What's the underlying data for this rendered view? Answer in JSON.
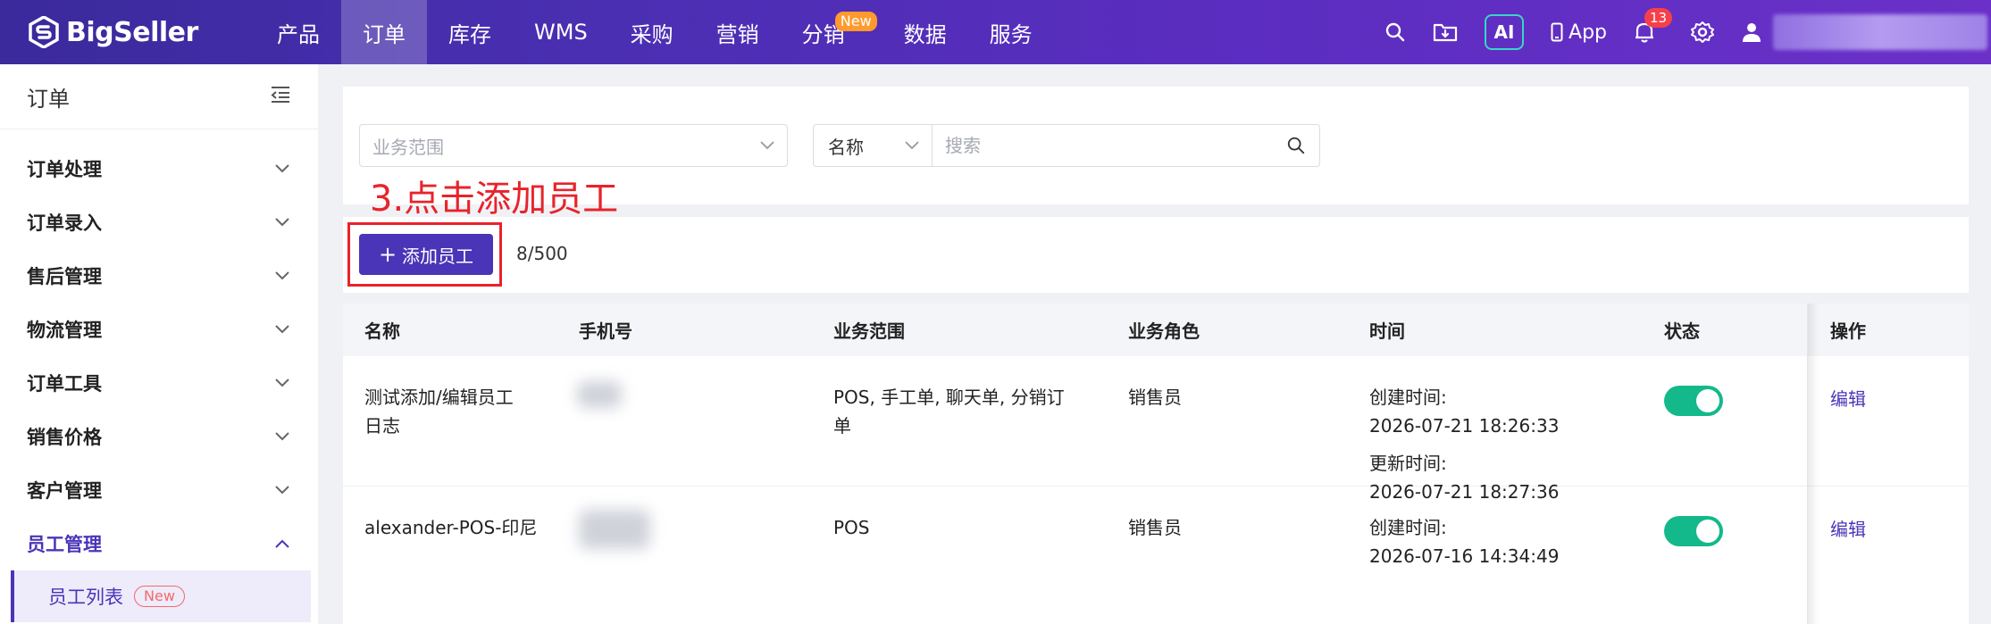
{
  "brand": {
    "name": "BigSeller"
  },
  "nav": {
    "items": [
      {
        "label": "产品"
      },
      {
        "label": "订单",
        "active": true
      },
      {
        "label": "库存"
      },
      {
        "label": "WMS"
      },
      {
        "label": "采购"
      },
      {
        "label": "营销"
      },
      {
        "label": "分销",
        "badge": "New"
      },
      {
        "label": "数据"
      },
      {
        "label": "服务"
      }
    ],
    "ai_label": "AI",
    "app_label": "App",
    "notification_count": "13"
  },
  "sidebar": {
    "title": "订单",
    "items": [
      {
        "label": "订单处理"
      },
      {
        "label": "订单录入"
      },
      {
        "label": "售后管理"
      },
      {
        "label": "物流管理"
      },
      {
        "label": "订单工具"
      },
      {
        "label": "销售价格"
      },
      {
        "label": "客户管理"
      },
      {
        "label": "员工管理"
      }
    ],
    "sub_item": {
      "label": "员工列表",
      "badge": "New"
    }
  },
  "filter": {
    "scope_placeholder": "业务范围",
    "search_type": "名称",
    "search_placeholder": "搜索"
  },
  "annotation": "3.点击添加员工",
  "toolbar": {
    "add_button": "添加员工",
    "count": "8/500"
  },
  "table": {
    "headers": [
      "名称",
      "手机号",
      "业务范围",
      "业务角色",
      "时间",
      "状态",
      "操作"
    ],
    "rows": [
      {
        "name_line1": "测试添加/编辑员工",
        "name_line2": "日志",
        "scope_line1": "POS, 手工单, 聊天单, 分销订",
        "scope_line2": "单",
        "role": "销售员",
        "created_label": "创建时间:",
        "created": "2026-07-21 18:26:33",
        "updated_label": "更新时间:",
        "updated": "2026-07-21 18:27:36",
        "status_on": true,
        "action": "编辑"
      },
      {
        "name_line1": "alexander-POS-印尼",
        "scope_line1": "POS",
        "role": "销售员",
        "created_label": "创建时间:",
        "created": "2026-07-16 14:34:49",
        "status_on": true,
        "action": "编辑"
      }
    ]
  },
  "colors": {
    "primary": "#4a35b8",
    "annotation": "#e8232b",
    "toggle_on": "#13b98a"
  }
}
